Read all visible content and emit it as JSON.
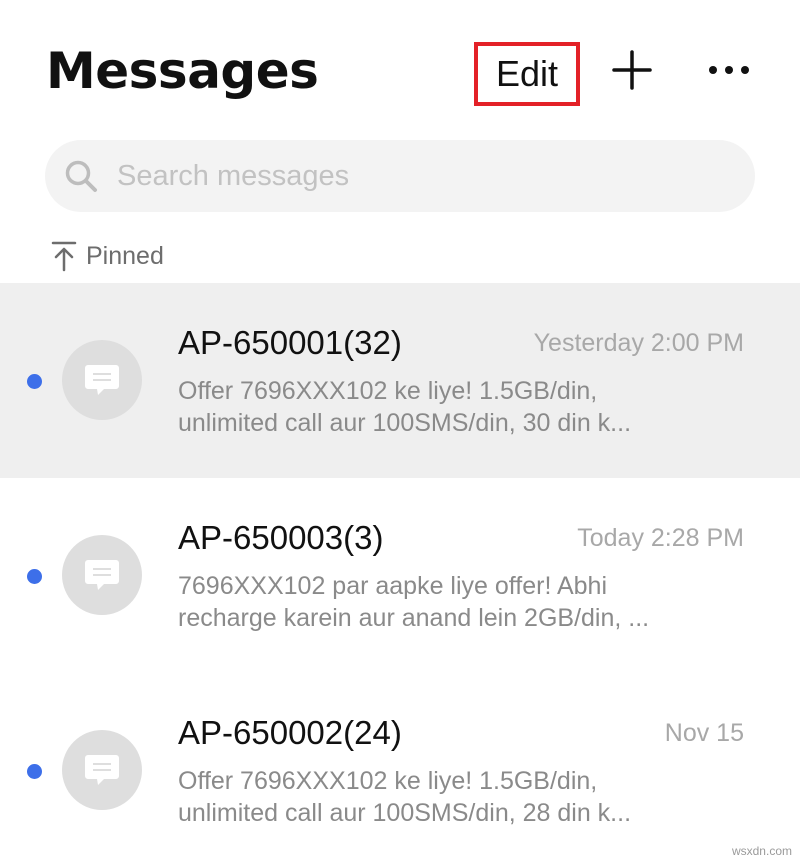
{
  "header": {
    "title": "Messages",
    "edit_label": "Edit",
    "add_icon": "plus-icon",
    "more_icon": "more-icon"
  },
  "search": {
    "placeholder": "Search messages",
    "value": "",
    "icon": "search-icon"
  },
  "pinned": {
    "label": "Pinned",
    "icon": "pin-icon"
  },
  "conversations": [
    {
      "sender": "AP-650001(32)",
      "time": "Yesterday 2:00 PM",
      "preview_line1": "Offer 7696XXX102 ke liye! 1.5GB/din,",
      "preview_line2": "unlimited call aur 100SMS/din, 30 din k...",
      "unread": true,
      "pinned": true
    },
    {
      "sender": "AP-650003(3)",
      "time": "Today 2:28 PM",
      "preview_line1": "7696XXX102 par aapke liye offer! Abhi",
      "preview_line2": "recharge karein aur anand lein 2GB/din, ...",
      "unread": true,
      "pinned": false
    },
    {
      "sender": "AP-650002(24)",
      "time": "Nov 15",
      "preview_line1": "Offer 7696XXX102 ke liye! 1.5GB/din,",
      "preview_line2": "unlimited call aur 100SMS/din, 28 din k...",
      "unread": true,
      "pinned": false
    }
  ],
  "colors": {
    "accent_unread": "#3d6fe9",
    "highlight_box": "#e32127",
    "pinned_row_bg": "#efefef"
  },
  "watermark": "wsxdn.com"
}
